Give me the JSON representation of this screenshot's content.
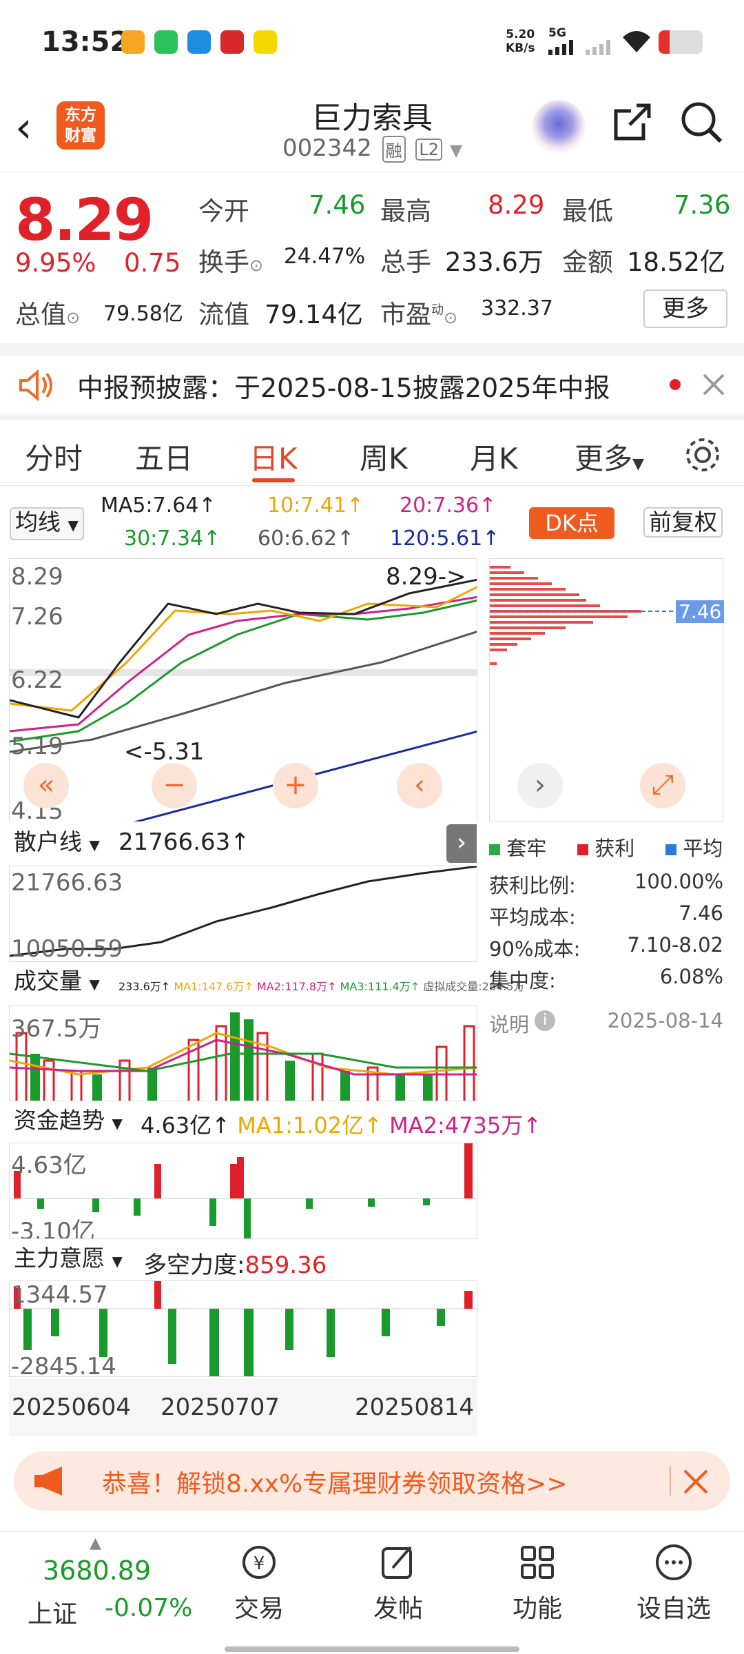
{
  "status_bar": {
    "time": "13:52",
    "speed_value": "5.20",
    "speed_unit": "KB/s",
    "network": "5G",
    "battery": "low"
  },
  "header": {
    "back": "‹",
    "logo_line1": "东方",
    "logo_line2": "财富",
    "stock_name": "巨力索具",
    "stock_code": "002342",
    "tag_margin": "融",
    "tag_level": "L2"
  },
  "quote": {
    "price": "8.29",
    "change_pct": "9.95%",
    "change_amt": "0.75",
    "open_label": "今开",
    "open": "7.46",
    "high_label": "最高",
    "high": "8.29",
    "low_label": "最低",
    "low": "7.36",
    "turnover_label": "换手",
    "turnover": "24.47%",
    "volume_label": "总手",
    "volume": "233.6万",
    "amount_label": "金额",
    "amount": "18.52亿",
    "mktcap_label": "总值",
    "mktcap": "79.58亿",
    "float_label": "流值",
    "float": "79.14亿",
    "pe_label": "市盈",
    "pe_sup": "动",
    "pe": "332.37",
    "more": "更多"
  },
  "notice": {
    "text": "中报预披露：于2025-08-15披露2025年中报"
  },
  "tabs": [
    {
      "label": "分时"
    },
    {
      "label": "五日"
    },
    {
      "label": "日K"
    },
    {
      "label": "周K"
    },
    {
      "label": "月K"
    },
    {
      "label": "更多"
    }
  ],
  "ma_bar": {
    "selector": "均线",
    "ma5": "MA5:7.64↑",
    "ma10": "10:7.41↑",
    "ma20": "20:7.36↑",
    "ma30": "30:7.34↑",
    "ma60": "60:6.62↑",
    "ma120": "120:5.61↑",
    "dk_button": "DK点",
    "adjust": "前复权"
  },
  "kline": {
    "y_labels": [
      "8.29",
      "7.26",
      "6.22",
      "5.19",
      "4.15"
    ],
    "last_marker": "8.29->",
    "low_marker": "<-5.31",
    "chip_price": "7.46"
  },
  "retail_line": {
    "selector": "散户线",
    "value": "21766.63↑",
    "max": "21766.63",
    "min": "10050.59"
  },
  "volume": {
    "selector": "成交量",
    "summary": "233.6万↑",
    "ma1": "MA1:147.6万↑",
    "ma2": "MA2:117.8万↑",
    "ma3": "MA3:111.4万↑",
    "virtual": "虚拟成交量:284.5万",
    "max": "367.5万"
  },
  "fund_trend": {
    "selector": "资金趋势",
    "value": "4.63亿↑",
    "ma1": "MA1:1.02亿↑",
    "ma2": "MA2:4735万↑",
    "max": "4.63亿",
    "min": "-3.10亿"
  },
  "main_force": {
    "selector": "主力意愿",
    "strength_label": "多空力度:",
    "strength": "859.36",
    "max": "1344.57",
    "min": "-2845.14"
  },
  "dates": [
    "20250604",
    "20250707",
    "20250814"
  ],
  "chip": {
    "legend": [
      {
        "label": "套牢",
        "color": "#2aa84a"
      },
      {
        "label": "获利",
        "color": "#e0212a"
      },
      {
        "label": "平均",
        "color": "#2a7ae0"
      }
    ],
    "rows": [
      {
        "label": "获利比例:",
        "value": "100.00%"
      },
      {
        "label": "平均成本:",
        "value": "7.46"
      },
      {
        "label": "90%成本:",
        "value": "7.10-8.02"
      },
      {
        "label": "集中度:",
        "value": "6.08%"
      }
    ],
    "note": "说明",
    "date": "2025-08-14"
  },
  "banner": {
    "text": "恭喜！解锁8.xx%专属理财券领取资格>>"
  },
  "bottom_nav": {
    "index_value": "3680.89",
    "index_name": "上证",
    "index_change": "-0.07%",
    "items": [
      {
        "label": "交易"
      },
      {
        "label": "发帖"
      },
      {
        "label": "功能"
      },
      {
        "label": "设自选"
      }
    ]
  },
  "colors": {
    "up": "#e0212a",
    "down": "#1a9a2a",
    "accent": "#ef5a1f",
    "ma10": "#f0a500",
    "ma20": "#d0208a",
    "ma30": "#1a9a2a",
    "ma60": "#555555",
    "ma120": "#1a2aa0"
  }
}
